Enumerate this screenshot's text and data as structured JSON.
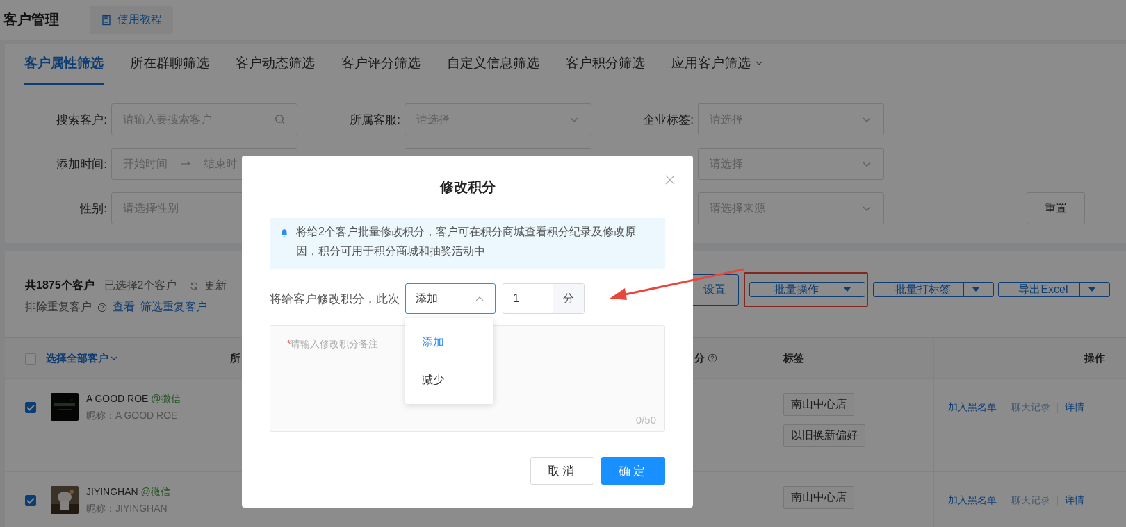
{
  "header": {
    "title": "客户管理",
    "tutorial_button": "使用教程"
  },
  "filter_tabs": [
    {
      "label": "客户属性筛选",
      "selected": true,
      "kind": "plain"
    },
    {
      "label": "所在群聊筛选",
      "selected": false,
      "kind": "plain"
    },
    {
      "label": "客户动态筛选",
      "selected": false,
      "kind": "plain"
    },
    {
      "label": "客户评分筛选",
      "selected": false,
      "kind": "plain"
    },
    {
      "label": "自定义信息筛选",
      "selected": false,
      "kind": "plain"
    },
    {
      "label": "客户积分筛选",
      "selected": false,
      "kind": "plain"
    },
    {
      "label": "应用客户筛选",
      "selected": false,
      "kind": "menu"
    }
  ],
  "filter_rows": [
    [
      {
        "label": "搜索客户:",
        "kind": "search",
        "placeholder": "请输入要搜索客户"
      },
      {
        "label": "所属客服:",
        "kind": "select",
        "placeholder": "请选择",
        "caret": true
      },
      {
        "label": "企业标签:",
        "kind": "select",
        "placeholder": "请选择",
        "caret": true
      }
    ],
    [
      {
        "label": "添加时间:",
        "kind": "date",
        "start_placeholder": "开始时间",
        "end_placeholder": "结束时"
      },
      {
        "kind": "select",
        "caret": false
      },
      {
        "kind": "select",
        "placeholder": "请选择",
        "caret": true
      }
    ],
    [
      {
        "label": "性别:",
        "kind": "select",
        "placeholder": "请选择性别",
        "caret": false
      },
      null,
      {
        "kind": "select",
        "placeholder": "请选择来源",
        "caret": true
      }
    ]
  ],
  "reset_button": "重置",
  "toolbar": {
    "total": "共1875个客户",
    "selected_count": "已选择2个客户",
    "refresh": "更新",
    "dedupe_label": "排除重复客户",
    "view_link": "查看",
    "dedupe_link": "筛选重复客户",
    "buttons": [
      {
        "label": "设置",
        "kind": "plain",
        "highlighted": false
      },
      {
        "label": "批量操作",
        "kind": "split",
        "highlighted": true
      },
      {
        "label": "批量打标签",
        "kind": "split",
        "highlighted": false
      },
      {
        "label": "导出Excel",
        "kind": "split",
        "highlighted": false
      }
    ]
  },
  "table": {
    "select_all": "选择全部客户",
    "select_all_checked": false,
    "columns": [
      {
        "label": "所",
        "help": false
      },
      {
        "label": "分",
        "help": true
      },
      {
        "label": "标签",
        "help": false
      },
      {
        "label": "操作",
        "help": false
      }
    ],
    "rows": [
      {
        "checked": true,
        "name": "A GOOD ROE",
        "source": "@微信",
        "nickname": "昵称：A GOOD ROE",
        "tags": [
          "南山中心店",
          "以旧换新偏好"
        ],
        "actions": [
          {
            "label": "加入黑名单",
            "disabled": false
          },
          {
            "label": "聊天记录",
            "disabled": true
          },
          {
            "label": "详情",
            "disabled": false
          }
        ]
      },
      {
        "checked": true,
        "name": "JIYINGHAN",
        "source": "@微信",
        "nickname": "昵称：JIYINGHAN",
        "tags": [
          "南山中心店"
        ],
        "actions": [
          {
            "label": "加入黑名单",
            "disabled": false
          },
          {
            "label": "聊天记录",
            "disabled": true
          },
          {
            "label": "详情",
            "disabled": false
          }
        ]
      }
    ]
  },
  "modal": {
    "title": "修改积分",
    "notice": "将给2个客户批量修改积分，客户可在积分商城查看积分纪录及修改原因，积分可用于积分商城和抽奖活动中",
    "prompt": "将给客户修改积分，此次",
    "mode_select": {
      "value": "添加",
      "expanded": true,
      "options": [
        {
          "label": "添加",
          "selected": true
        },
        {
          "label": "减少",
          "selected": false
        }
      ]
    },
    "amount": {
      "value": "1",
      "unit": "分"
    },
    "note": {
      "placeholder": "请输入修改积分备注",
      "required_mark": "*",
      "counter": "0/50"
    },
    "cancel_button": "取消",
    "confirm_button": "确定"
  }
}
